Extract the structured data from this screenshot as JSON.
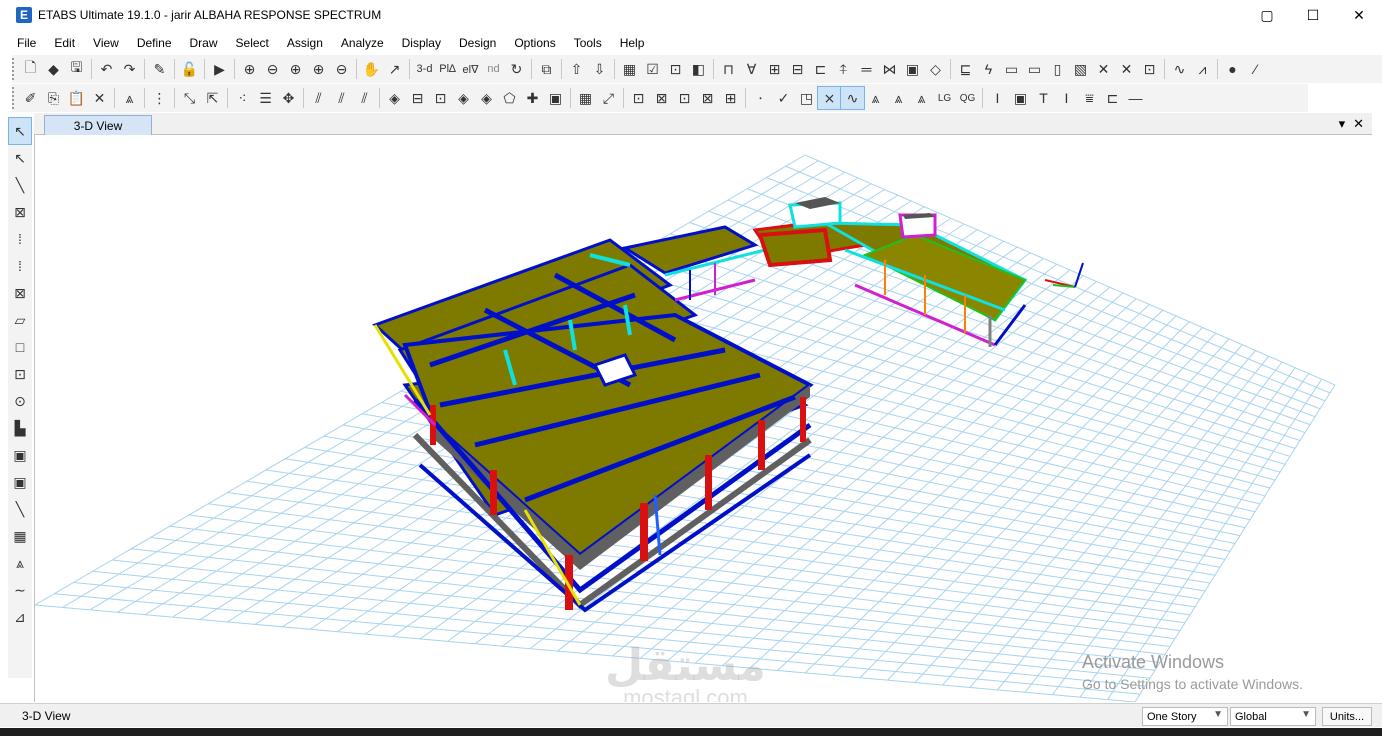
{
  "app": {
    "icon_letter": "E",
    "title": "ETABS Ultimate 19.1.0 - jarir ALBAHA RESPONSE SPECTRUM",
    "window_controls": [
      "▢",
      "☐",
      "✕"
    ]
  },
  "menu": [
    "File",
    "Edit",
    "View",
    "Define",
    "Draw",
    "Select",
    "Assign",
    "Analyze",
    "Display",
    "Design",
    "Options",
    "Tools",
    "Help"
  ],
  "toolbar1_text": {
    "view_3d": "3-d",
    "plan": "Pl∆",
    "elev": "el∇",
    "nd": "nd"
  },
  "tab": {
    "label": "3-D View",
    "controls": [
      "▾",
      "✕"
    ]
  },
  "status": {
    "view_label": "3-D View",
    "story_select": "One Story",
    "coord_select": "Global",
    "units_button": "Units..."
  },
  "os_overlay": {
    "activate_title": "Activate Windows",
    "activate_sub": "Go to Settings to activate Windows."
  },
  "watermark": {
    "arabic": "مستقل",
    "latin": "mostaql.com"
  },
  "colors": {
    "slab": "#7e7a00",
    "beam_blue": "#0010c8",
    "column_red": "#d81010",
    "brace_cyan": "#10e0e0",
    "grid": "#a9d3ee",
    "magenta": "#d020d0",
    "yellow": "#e8e000",
    "green": "#20c020"
  }
}
